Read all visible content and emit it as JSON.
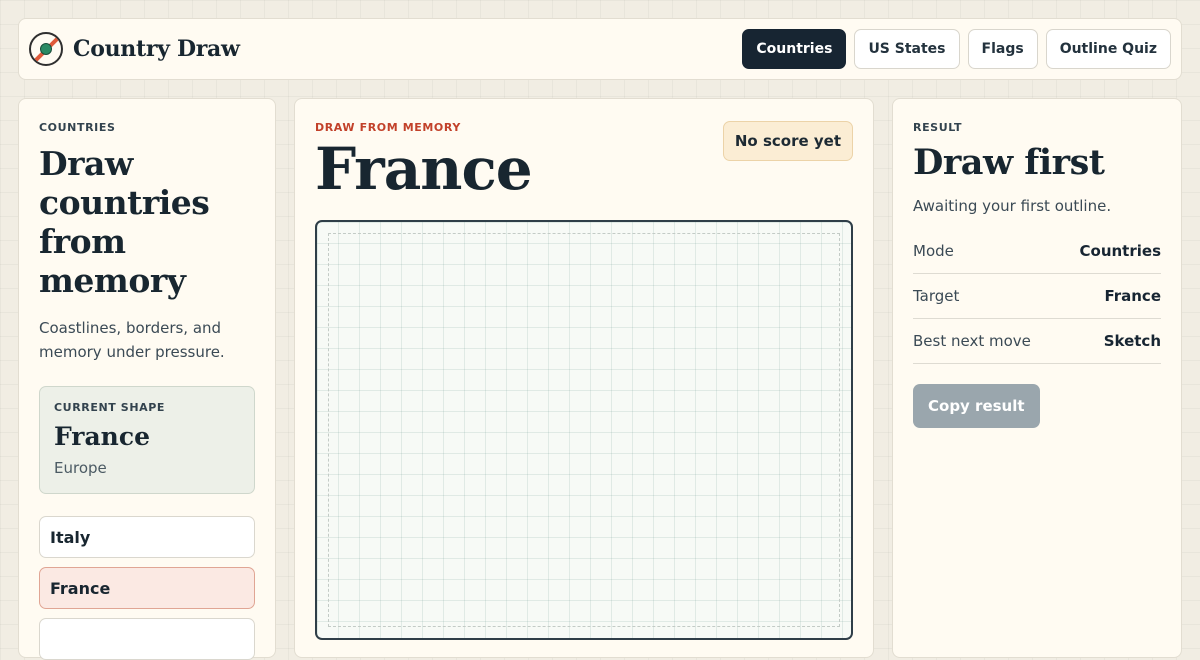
{
  "brand": {
    "name": "Country Draw",
    "logo_icon": "compass-icon"
  },
  "nav": [
    {
      "label": "Countries",
      "active": true
    },
    {
      "label": "US States",
      "active": false
    },
    {
      "label": "Flags",
      "active": false
    },
    {
      "label": "Outline Quiz",
      "active": false
    }
  ],
  "left": {
    "eyebrow": "COUNTRIES",
    "title": "Draw countries from memory",
    "description": "Coastlines, borders, and memory under pressure.",
    "current_shape": {
      "label": "CURRENT SHAPE",
      "name": "France",
      "region": "Europe"
    },
    "countries": [
      {
        "name": "Italy",
        "selected": false
      },
      {
        "name": "France",
        "selected": true
      },
      {
        "name": "",
        "selected": false
      }
    ]
  },
  "center": {
    "eyebrow": "DRAW FROM MEMORY",
    "target": "France",
    "score_badge": "No score yet"
  },
  "right": {
    "eyebrow": "RESULT",
    "title": "Draw first",
    "description": "Awaiting your first outline.",
    "stats": [
      {
        "label": "Mode",
        "value": "Countries"
      },
      {
        "label": "Target",
        "value": "France"
      },
      {
        "label": "Best next move",
        "value": "Sketch"
      }
    ],
    "copy_button": "Copy result"
  },
  "colors": {
    "accent_dark": "#172532",
    "accent_red": "#c2412a",
    "selected_bg": "#fbe9e3",
    "disabled_button": "#9aa6ad"
  }
}
